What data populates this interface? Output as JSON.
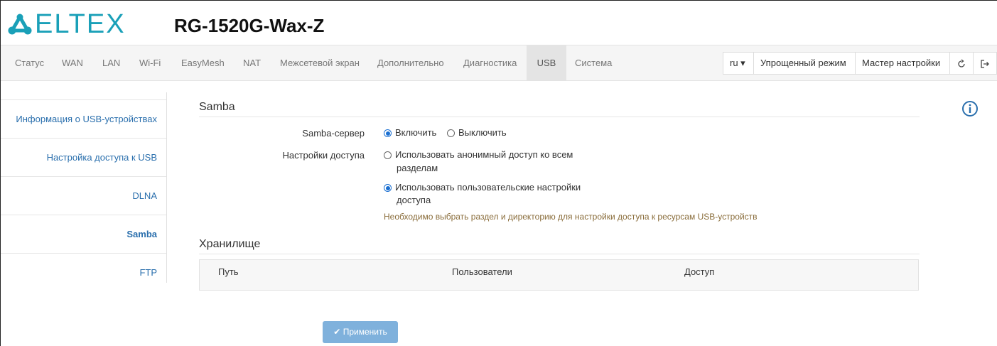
{
  "header": {
    "logo_text": "ELTEX",
    "model": "RG-1520G-Wax-Z"
  },
  "nav": {
    "items": [
      "Статус",
      "WAN",
      "LAN",
      "Wi-Fi",
      "EasyMesh",
      "NAT",
      "Межсетевой экран",
      "Дополнительно",
      "Диагностика",
      "USB",
      "Система"
    ],
    "active": "USB",
    "language": "ru ▾",
    "simple_mode": "Упрощенный режим",
    "wizard": "Мастер настройки",
    "refresh_icon": "↻",
    "logout_icon": "⇥"
  },
  "sidebar": {
    "items": [
      "Информация о USB-устройствах",
      "Настройка доступа к USB",
      "DLNA",
      "Samba",
      "FTP"
    ],
    "active": "Samba"
  },
  "samba": {
    "title": "Samba",
    "server_label": "Samba-сервер",
    "enable": "Включить",
    "disable": "Выключить",
    "access_label": "Настройки доступа",
    "anon_line1": "Использовать анонимный доступ ко всем",
    "anon_line2": "разделам",
    "custom_line1": "Использовать пользовательские настройки",
    "custom_line2": "доступа",
    "warning": "Необходимо выбрать раздел и директорию для настройки доступа к ресурсам USB-устройств"
  },
  "storage": {
    "title": "Хранилище",
    "columns": [
      "Путь",
      "Пользователи",
      "Доступ"
    ]
  },
  "apply_button": "Применить",
  "colors": {
    "logo": "#1aa0b8",
    "link": "#2a6fad",
    "warning": "#8a6d3b",
    "apply": "#7fb1dc"
  }
}
